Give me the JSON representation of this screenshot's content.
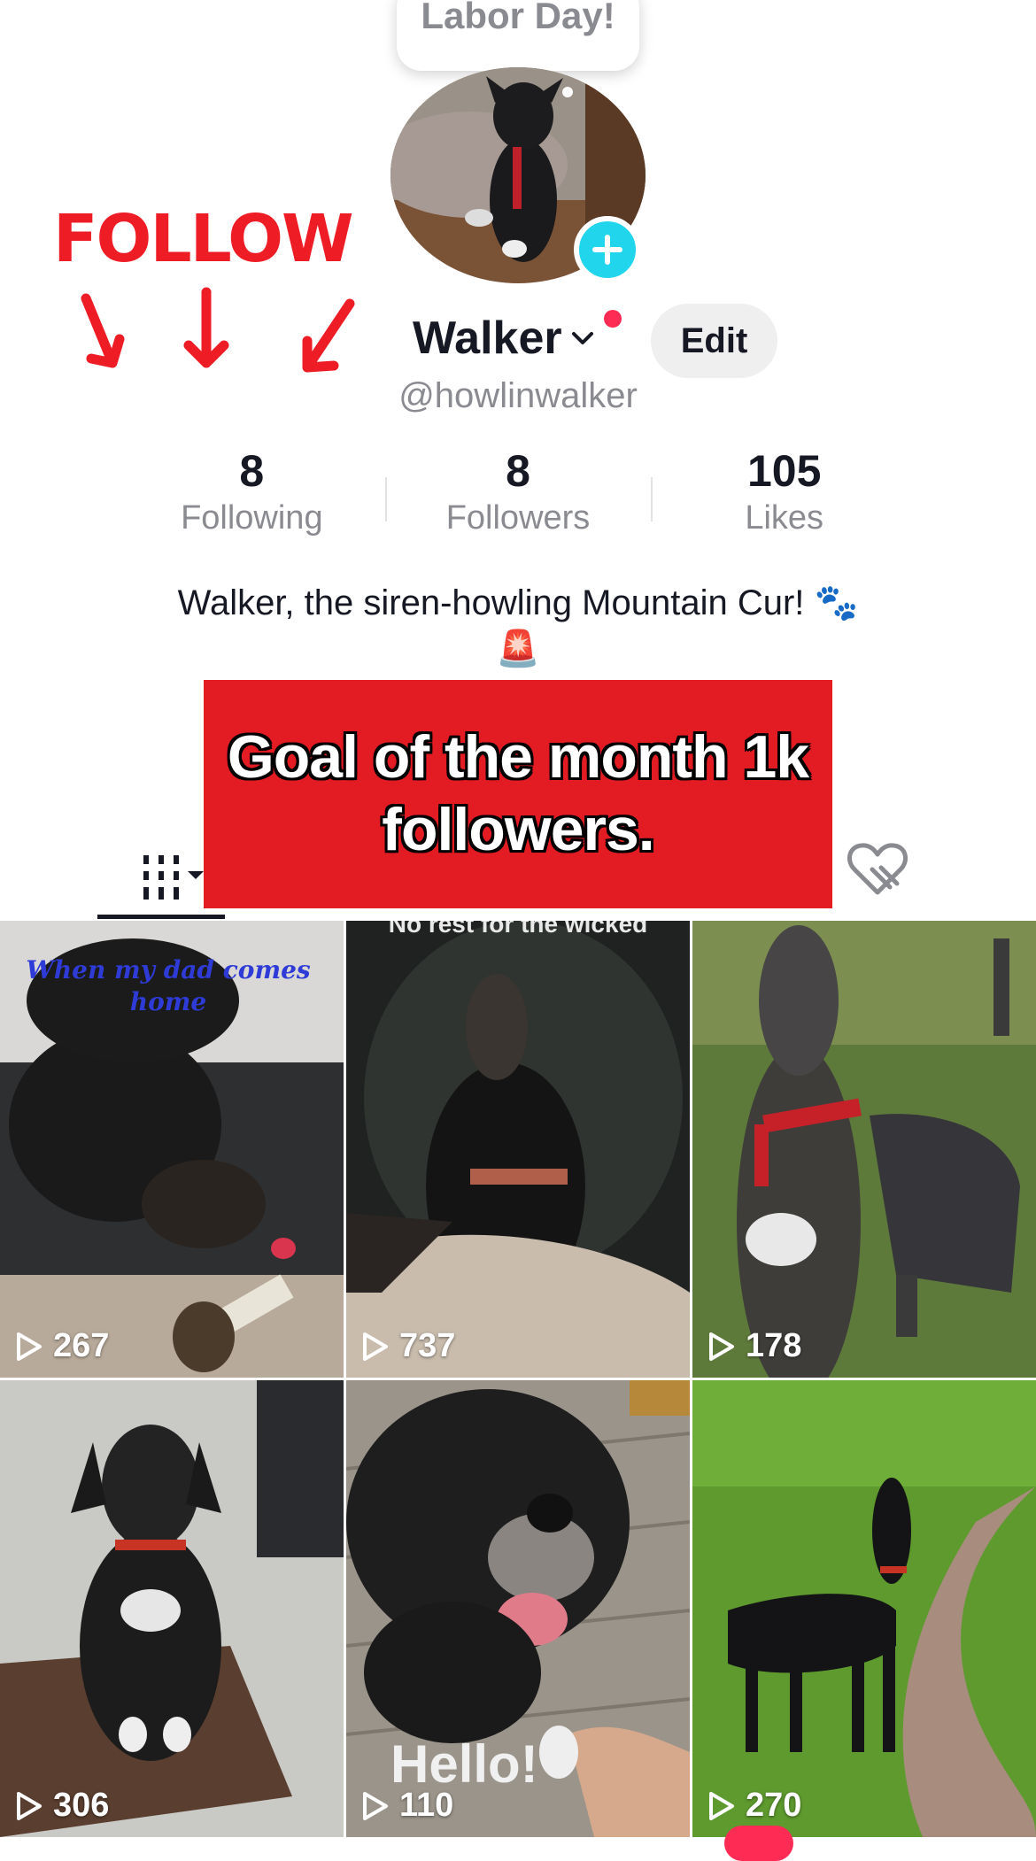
{
  "popup": {
    "text": "Labor Day!"
  },
  "overlay": {
    "follow_text": "FOLLOW"
  },
  "profile": {
    "name": "Walker",
    "handle": "@howlinwalker",
    "edit_label": "Edit",
    "bio": "Walker, the siren-howling Mountain Cur! 🐾",
    "bio_emoji": "🚨"
  },
  "stats": [
    {
      "value": "8",
      "label": "Following"
    },
    {
      "value": "8",
      "label": "Followers"
    },
    {
      "value": "105",
      "label": "Likes"
    }
  ],
  "banner": {
    "text": "Goal of the month 1k followers."
  },
  "videos": [
    {
      "views": "267",
      "caption": "When my dad comes home"
    },
    {
      "views": "737",
      "caption": "No rest for the wicked"
    },
    {
      "views": "178"
    },
    {
      "views": "306"
    },
    {
      "views": "110",
      "caption": "Hello!"
    },
    {
      "views": "270"
    }
  ],
  "colors": {
    "accent": "#fe2c55",
    "plus": "#20d5ec",
    "banner": "#e31b23",
    "follow_doodle": "#ee1c25"
  },
  "icons": [
    "plus-icon",
    "chevron-down-icon",
    "grid-icon",
    "liked-heart-icon",
    "play-icon"
  ]
}
